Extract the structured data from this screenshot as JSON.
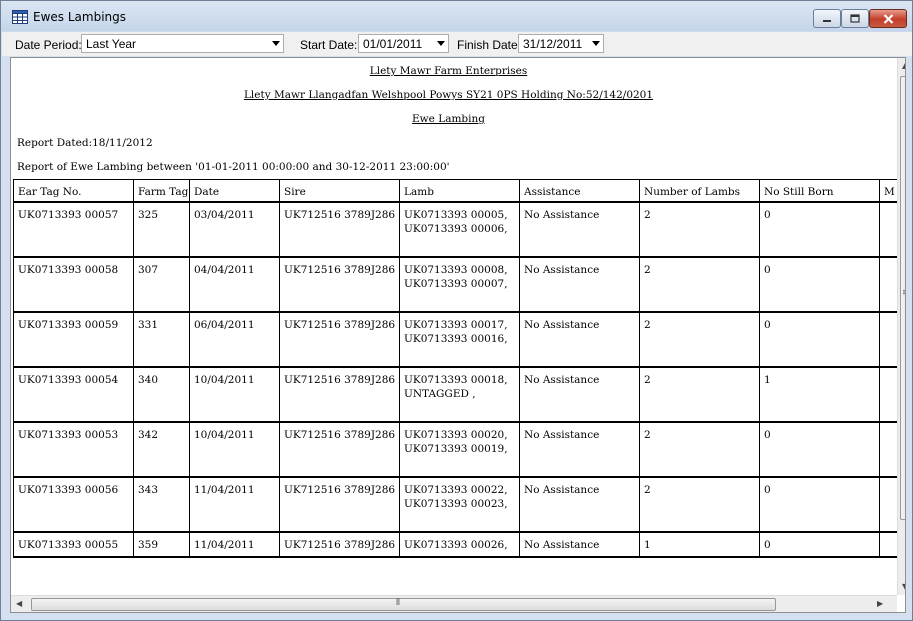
{
  "window": {
    "title": "Ewes Lambings"
  },
  "toolbar": {
    "date_period_label": "Date Period:",
    "date_period_value": "Last Year",
    "start_date_label": "Start Date:",
    "start_date_value": "01/01/2011",
    "finish_date_label": "Finish Date:",
    "finish_date_value": "31/12/2011"
  },
  "report": {
    "company": "Llety Mawr Farm Enterprises",
    "address": "Llety Mawr Llangadfan Welshpool Powys SY21 0PS Holding No:52/142/0201",
    "title": "Ewe Lambing",
    "dated": "Report Dated:18/11/2012",
    "range": "Report of Ewe Lambing between '01-01-2011 00:00:00 and 30-12-2011 23:00:00'",
    "columns": [
      "Ear Tag No.",
      "Farm Tag",
      "Date",
      "Sire",
      "Lamb",
      "Assistance",
      "Number of Lambs",
      "No Still Born",
      "M"
    ],
    "rows": [
      {
        "ear_tag": "UK0713393 00057",
        "farm_tag": "325",
        "date": "03/04/2011",
        "sire": "UK712516 3789J286",
        "lamb1": "UK0713393 00005,",
        "lamb2": "UK0713393 00006,",
        "assistance": "No Assistance",
        "num_lambs": "2",
        "still_born": "0"
      },
      {
        "ear_tag": "UK0713393 00058",
        "farm_tag": "307",
        "date": "04/04/2011",
        "sire": "UK712516 3789J286",
        "lamb1": "UK0713393 00008,",
        "lamb2": "UK0713393 00007,",
        "assistance": "No Assistance",
        "num_lambs": "2",
        "still_born": "0"
      },
      {
        "ear_tag": "UK0713393 00059",
        "farm_tag": "331",
        "date": "06/04/2011",
        "sire": "UK712516 3789J286",
        "lamb1": "UK0713393 00017,",
        "lamb2": "UK0713393 00016,",
        "assistance": "No Assistance",
        "num_lambs": "2",
        "still_born": "0"
      },
      {
        "ear_tag": "UK0713393 00054",
        "farm_tag": "340",
        "date": "10/04/2011",
        "sire": "UK712516 3789J286",
        "lamb1": "UK0713393 00018,",
        "lamb2": "UNTAGGED ,",
        "assistance": "No Assistance",
        "num_lambs": "2",
        "still_born": "1"
      },
      {
        "ear_tag": "UK0713393 00053",
        "farm_tag": "342",
        "date": "10/04/2011",
        "sire": "UK712516 3789J286",
        "lamb1": "UK0713393 00020,",
        "lamb2": "UK0713393 00019,",
        "assistance": "No Assistance",
        "num_lambs": "2",
        "still_born": "0"
      },
      {
        "ear_tag": "UK0713393 00056",
        "farm_tag": "343",
        "date": "11/04/2011",
        "sire": "UK712516 3789J286",
        "lamb1": "UK0713393 00022,",
        "lamb2": "UK0713393 00023,",
        "assistance": "No Assistance",
        "num_lambs": "2",
        "still_born": "0"
      },
      {
        "ear_tag": "UK0713393 00055",
        "farm_tag": "359",
        "date": "11/04/2011",
        "sire": "UK712516 3789J286",
        "lamb1": "UK0713393 00026,",
        "lamb2": "",
        "assistance": "No Assistance",
        "num_lambs": "1",
        "still_born": "0"
      }
    ]
  },
  "icons": {
    "app": "grid-table-icon",
    "minimize": "minimize-icon",
    "maximize": "maximize-icon",
    "close": "close-icon",
    "dropdown": "chevron-down-icon"
  },
  "colors": {
    "close_button": "#c3402a",
    "title_bar": "#c5d5ea"
  }
}
